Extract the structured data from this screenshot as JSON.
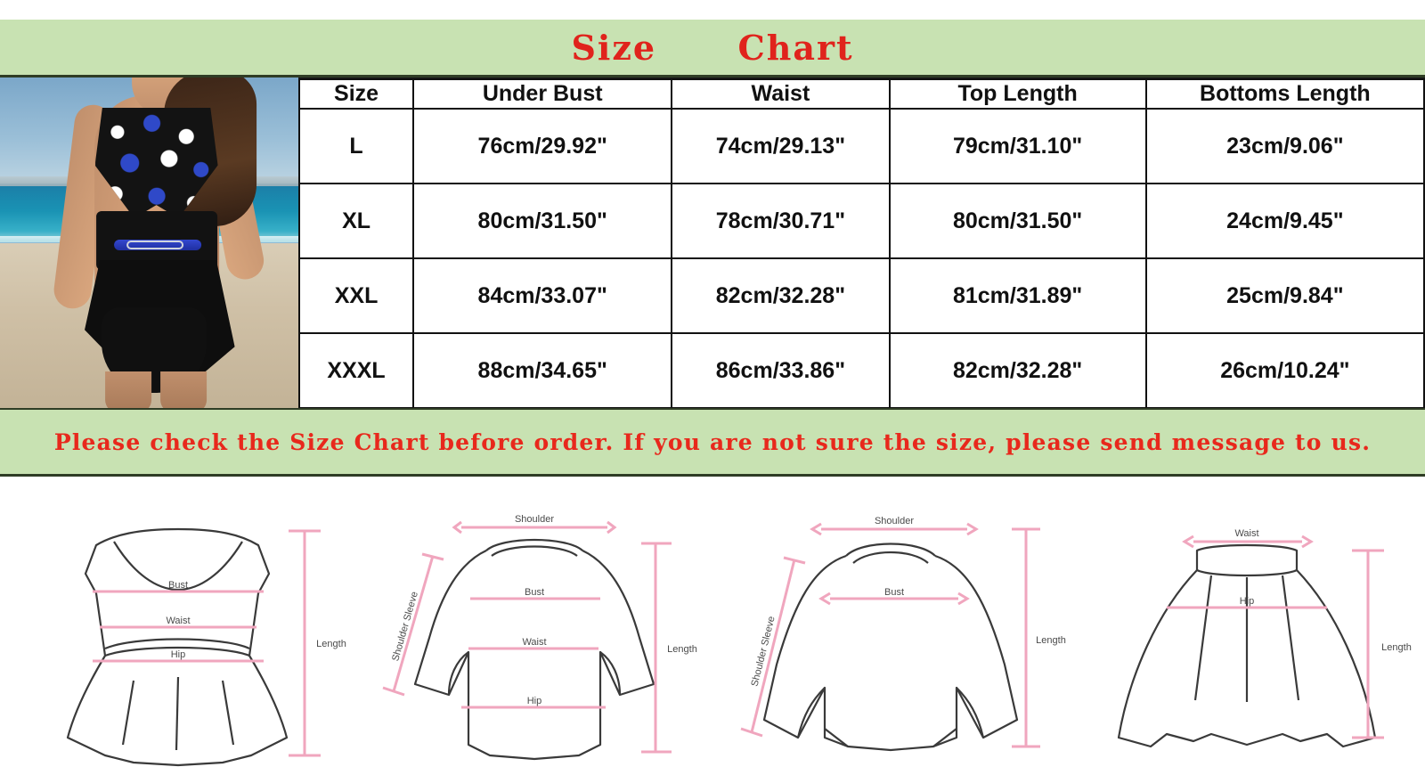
{
  "header": {
    "title": "Size      Chart",
    "banner_color": "#c8e2b2",
    "title_color": "#e0231c"
  },
  "photo": {
    "alt": "woman-in-polka-dot-tankini-on-beach"
  },
  "table": {
    "columns": [
      "Size",
      "Under Bust",
      "Waist",
      "Top Length",
      "Bottoms Length"
    ],
    "rows": [
      {
        "size": "L",
        "under_bust": "76cm/29.92\"",
        "waist": "74cm/29.13\"",
        "top_length": "79cm/31.10\"",
        "bottoms_length": "23cm/9.06\""
      },
      {
        "size": "XL",
        "under_bust": "80cm/31.50\"",
        "waist": "78cm/30.71\"",
        "top_length": "80cm/31.50\"",
        "bottoms_length": "24cm/9.45\""
      },
      {
        "size": "XXL",
        "under_bust": "84cm/33.07\"",
        "waist": "82cm/32.28\"",
        "top_length": "81cm/31.89\"",
        "bottoms_length": "25cm/9.84\""
      },
      {
        "size": "XXXL",
        "under_bust": "88cm/34.65\"",
        "waist": "86cm/33.86\"",
        "top_length": "82cm/32.28\"",
        "bottoms_length": "26cm/10.24\""
      }
    ]
  },
  "notice": {
    "text": "Please check the Size Chart before order. If you are not sure the size, please send message to us.",
    "color": "#e8281c",
    "banner_color": "#c8e2b2"
  },
  "diagrams": {
    "measure_line_color": "#f0a6be",
    "outline_color": "#3a3a3a",
    "label_color": "#4a4a4a",
    "items": [
      {
        "name": "sleeveless-dress",
        "labels": {
          "bust": "Bust",
          "waist": "Waist",
          "hip": "Hip",
          "length": "Length"
        }
      },
      {
        "name": "long-sleeve-dress",
        "labels": {
          "shoulder": "Shoulder",
          "shoulder_sleeve": "Shoulder Sleeve",
          "bust": "Bust",
          "waist": "Waist",
          "hip": "Hip",
          "length": "Length"
        }
      },
      {
        "name": "sweatshirt",
        "labels": {
          "shoulder": "Shoulder",
          "shoulder_sleeve": "Shoulder Sleeve",
          "bust": "Bust",
          "length": "Length"
        }
      },
      {
        "name": "skirt",
        "labels": {
          "waist": "Waist",
          "hip": "Hip",
          "length": "Length"
        }
      }
    ]
  }
}
